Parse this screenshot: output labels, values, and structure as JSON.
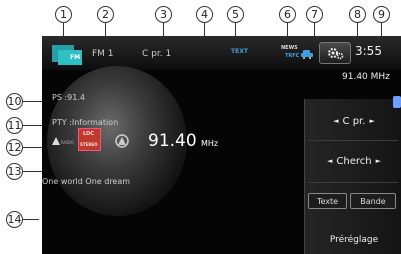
{
  "callouts": [
    "1",
    "2",
    "3",
    "4",
    "5",
    "6",
    "7",
    "8",
    "9",
    "10",
    "11",
    "12",
    "13",
    "14"
  ],
  "header": {
    "logo_text": "FM",
    "band": "FM 1",
    "preset": "C pr. 1",
    "text_indicator": "TEXT",
    "news_indicator": "NEWS",
    "trfc_indicator": "TRFC",
    "clock": "3:55",
    "frequency_small": "91.40 MHz"
  },
  "info": {
    "ps": "PS  :91.4",
    "pty": "PTY :Information",
    "stereo_badge": "STEREO",
    "radio_badge": "RADIO",
    "local_badge": "LOC",
    "frequency_large": "91.40",
    "frequency_unit": "MHz",
    "radio_text": "One world One dream"
  },
  "side": {
    "preset_btn": "C pr.",
    "search_btn": "Cherch",
    "text_btn": "Texte",
    "band_btn": "Bande",
    "preset_list_btn": "Préréglage"
  },
  "colors": {
    "screen_bg": "#050505",
    "logo_teal": "#2fc0c4",
    "indicator_blue": "#3fa0e0",
    "badge_red": "#c0392b"
  }
}
